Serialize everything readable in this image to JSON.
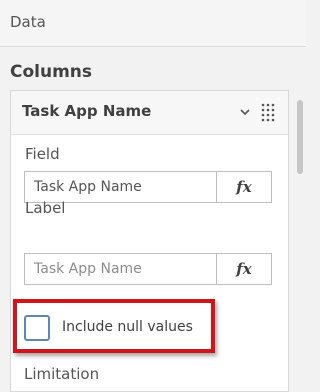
{
  "header": {
    "title": "Data"
  },
  "section": {
    "heading": "Columns"
  },
  "column_panel": {
    "title": "Task App Name",
    "field": {
      "label": "Field",
      "value": "Task App Name",
      "fx_label": "fx"
    },
    "label_field": {
      "label": "Label",
      "placeholder": "Task App Name",
      "fx_label": "fx"
    },
    "include_null": {
      "label": "Include null values",
      "checked": false
    },
    "next_section_label": "Limitation"
  },
  "colors": {
    "highlight": "#d0141a",
    "checkbox_border": "#5a89b8"
  },
  "icons": [
    "chevron-down-icon",
    "drag-handle-icon"
  ]
}
